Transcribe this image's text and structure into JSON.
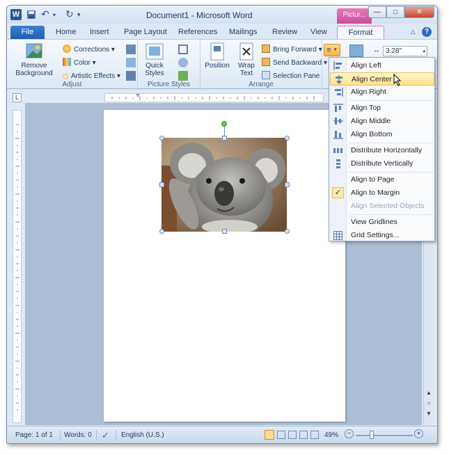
{
  "window": {
    "title": "Document1  -  Microsoft Word",
    "contextual_tab_header": "Pictur...",
    "buttons": [
      "—",
      "□",
      "✕"
    ]
  },
  "tabs": [
    "File",
    "Home",
    "Insert",
    "Page Layout",
    "References",
    "Mailings",
    "Review",
    "View",
    "Format"
  ],
  "ribbon": {
    "remove_background": "Remove Background",
    "adjust": {
      "corrections": "Corrections",
      "color": "Color",
      "artistic_effects": "Artistic Effects",
      "label": "Adjust"
    },
    "picture_styles": {
      "quick_styles": "Quick Styles",
      "label": "Picture Styles"
    },
    "arrange": {
      "position": "Position",
      "wrap_text": "Wrap Text",
      "bring_forward": "Bring Forward",
      "send_backward": "Send Backward",
      "selection_pane": "Selection Pane",
      "label": "Arrange"
    },
    "size_value": "3.28\""
  },
  "align_menu": {
    "items": [
      {
        "label": "Align Left",
        "icon": "align-left-icon"
      },
      {
        "label": "Align Center",
        "icon": "align-center-icon",
        "highlighted": true
      },
      {
        "label": "Align Right",
        "icon": "align-right-icon"
      },
      {
        "label": "Align Top",
        "icon": "align-top-icon"
      },
      {
        "label": "Align Middle",
        "icon": "align-middle-icon"
      },
      {
        "label": "Align Bottom",
        "icon": "align-bottom-icon"
      },
      {
        "label": "Distribute Horizontally",
        "icon": "distribute-horizontally-icon"
      },
      {
        "label": "Distribute Vertically",
        "icon": "distribute-vertically-icon"
      },
      {
        "label": "Align to Page",
        "icon": ""
      },
      {
        "label": "Align to Margin",
        "icon": "checkmark-icon",
        "checked": true
      },
      {
        "label": "Align Selected Objects",
        "icon": "",
        "disabled": true
      },
      {
        "label": "View Gridlines",
        "icon": ""
      },
      {
        "label": "Grid Settings...",
        "icon": "grid-settings-icon"
      }
    ]
  },
  "status": {
    "page": "Page: 1 of 1",
    "words": "Words: 0",
    "language": "English (U.S.)",
    "zoom": "49%"
  },
  "colors": {
    "file_tab": "#2a68bf",
    "contextual_tab": "#d65ea8",
    "menu_highlight": "#ffe38a"
  }
}
